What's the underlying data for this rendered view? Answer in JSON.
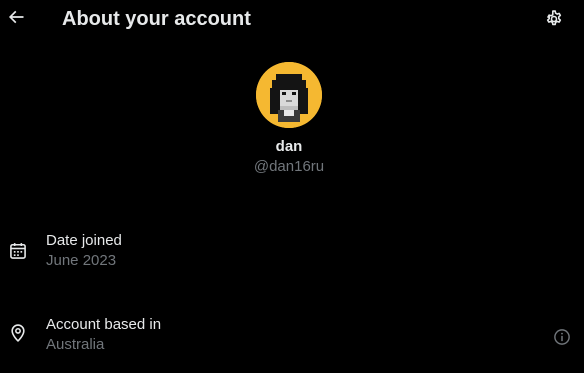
{
  "header": {
    "title": "About your account",
    "back_icon": "arrow-left-icon",
    "settings_icon": "gear-icon"
  },
  "profile": {
    "display_name": "dan",
    "handle": "@dan16ru",
    "avatar_background": "#f5b831"
  },
  "details": {
    "date_joined": {
      "icon": "calendar-icon",
      "label": "Date joined",
      "value": "June 2023"
    },
    "account_based_in": {
      "icon": "location-pin-icon",
      "label": "Account based in",
      "value": "Australia",
      "info_icon": "info-icon"
    }
  },
  "colors": {
    "background": "#000000",
    "primary_text": "#e7e9ea",
    "secondary_text": "#71767b"
  }
}
